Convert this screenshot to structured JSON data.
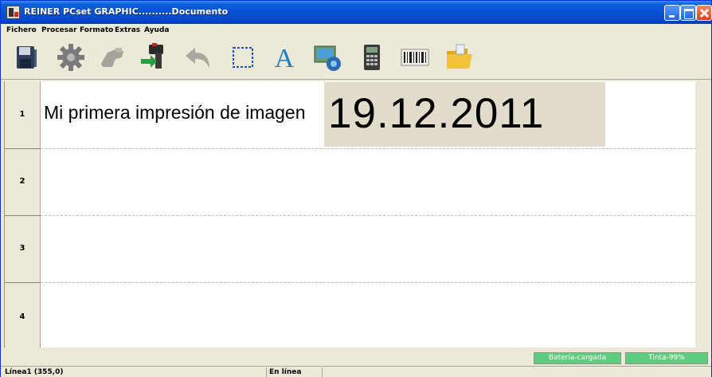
{
  "window": {
    "title": "REINER PCset GRAPHIC..........Documento"
  },
  "menu": {
    "items": [
      "Fichero",
      "Procesar",
      "Formato",
      "Extras",
      "Ayuda"
    ]
  },
  "toolbar": {
    "icons": [
      "save-icon",
      "settings-gear-icon",
      "hand-icon",
      "printer-transfer-icon",
      "undo-arrow-icon",
      "selection-rectangle-icon",
      "text-icon",
      "image-insert-icon",
      "calculator-icon",
      "barcode-icon",
      "folder-open-icon"
    ]
  },
  "document": {
    "rows": [
      {
        "number": "1",
        "text": "Mi primera impresión de imagen",
        "date": "19.12.2011"
      },
      {
        "number": "2"
      },
      {
        "number": "3"
      },
      {
        "number": "4"
      }
    ]
  },
  "status": {
    "battery": "Batería-cargada",
    "ink": "Tinta-99%",
    "position": "Línea1 (355,0)",
    "connection": "En línea"
  },
  "colors": {
    "titlebar": "#0450d0",
    "status_ok": "#5fcd7e",
    "chrome": "#ece9d8"
  }
}
